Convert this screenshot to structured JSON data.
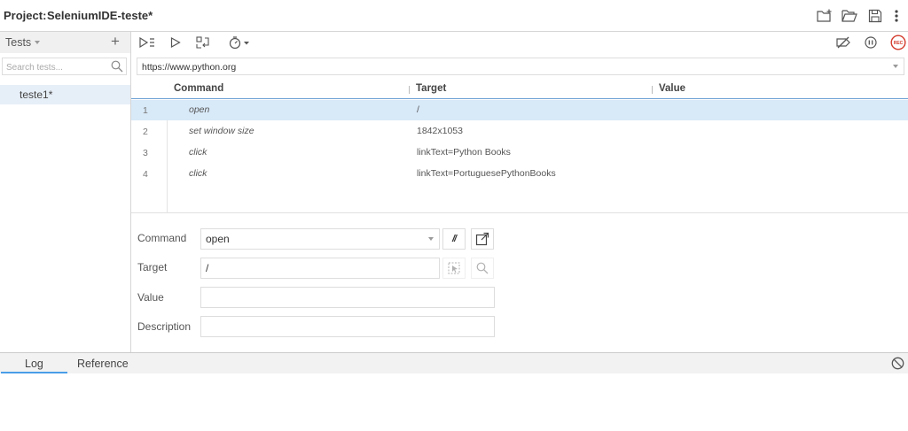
{
  "header": {
    "project_label": "Project:",
    "project_name": "SeleniumIDE-teste*",
    "icons": [
      "new-project-icon",
      "open-project-icon",
      "save-project-icon",
      "more-options-icon"
    ]
  },
  "sidebar": {
    "title": "Tests",
    "add_icon": "+",
    "search_placeholder": "Search tests...",
    "tests": [
      {
        "name": "teste1*",
        "selected": true
      }
    ]
  },
  "toolbar": {
    "icons": [
      "run-all-tests-icon",
      "run-current-test-icon",
      "step-over-icon",
      "test-speed-icon",
      "disable-breakpoints-icon",
      "pause-on-exceptions-icon",
      "record-icon"
    ],
    "rec_label": "REC"
  },
  "url": {
    "value": "https://www.python.org"
  },
  "table": {
    "headers": {
      "command": "Command",
      "target": "Target",
      "value": "Value"
    },
    "rows": [
      {
        "num": "1",
        "command": "open",
        "target": "/",
        "value": "",
        "selected": true
      },
      {
        "num": "2",
        "command": "set window size",
        "target": "1842x1053",
        "value": "",
        "selected": false
      },
      {
        "num": "3",
        "command": "click",
        "target": "linkText=Python Books",
        "value": "",
        "selected": false
      },
      {
        "num": "4",
        "command": "click",
        "target": "linkText=PortuguesePythonBooks",
        "value": "",
        "selected": false
      }
    ]
  },
  "editor": {
    "command_label": "Command",
    "command_value": "open",
    "comment_button": "//",
    "target_label": "Target",
    "target_value": "/",
    "value_label": "Value",
    "value_value": "",
    "description_label": "Description",
    "description_value": ""
  },
  "bottom": {
    "tabs": [
      "Log",
      "Reference"
    ],
    "active_tab": "Log"
  },
  "colors": {
    "selected_row": "#d8e9f8",
    "accent": "#4a9ee8",
    "record": "#d33a2c"
  }
}
